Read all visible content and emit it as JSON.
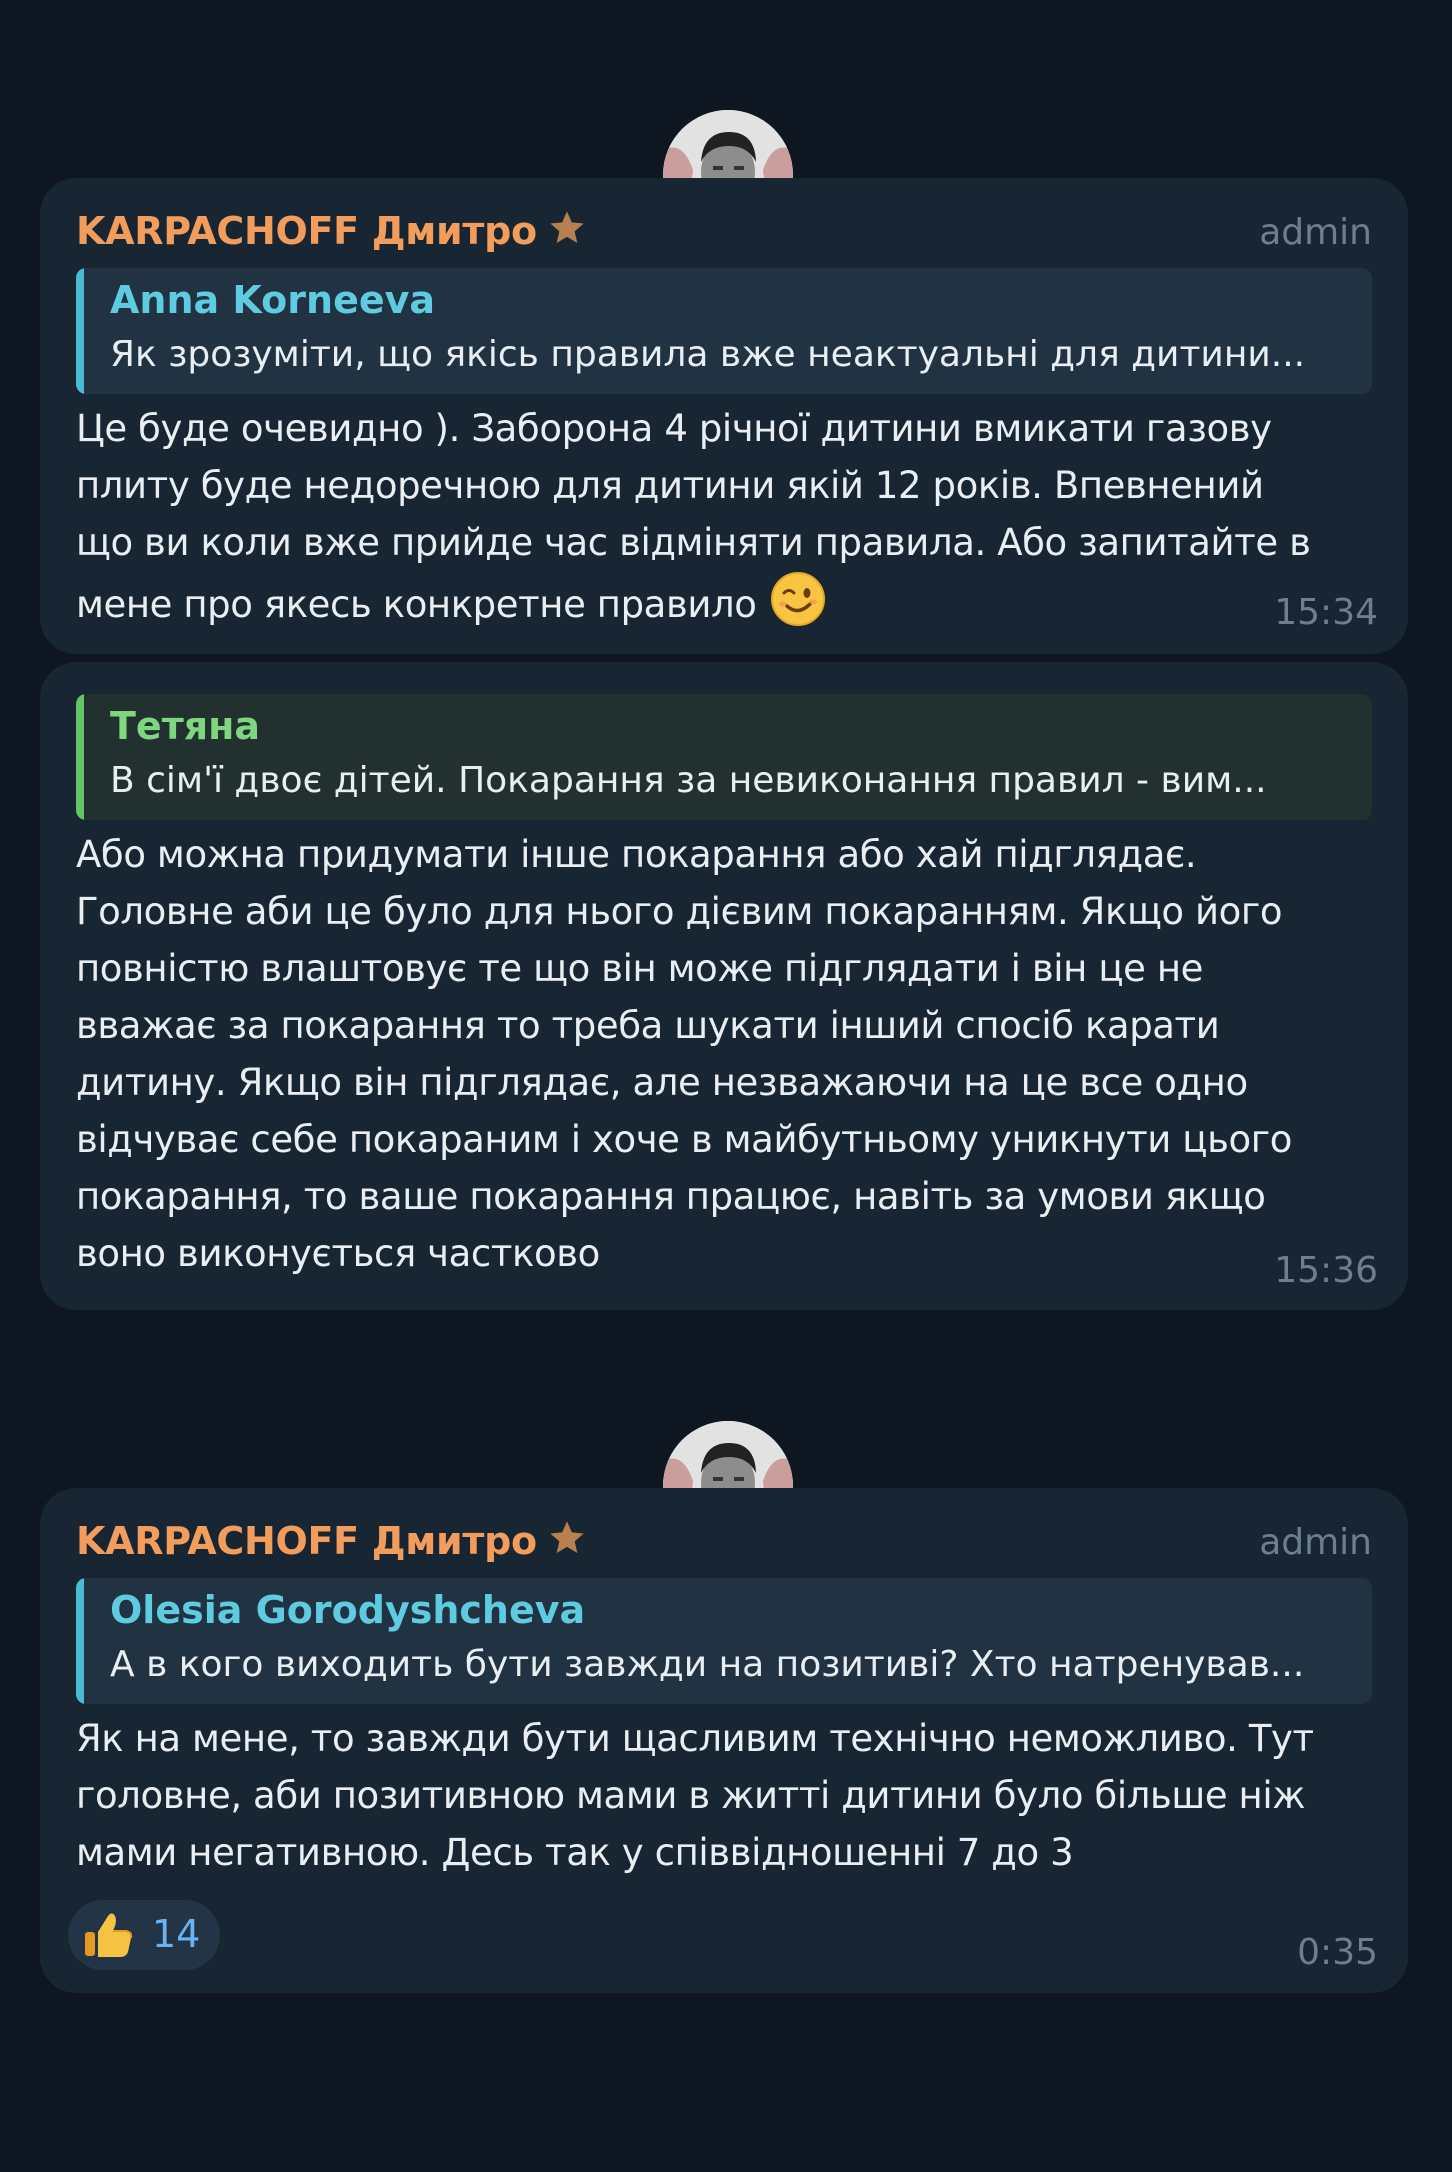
{
  "messages": [
    {
      "author": "KARPACHOFF Дмитро",
      "role": "admin",
      "reply": {
        "name": "Anna Korneeva",
        "text": "Як зрозуміти, що якісь правила вже неактуальні для дитини..."
      },
      "lines": [
        "Це буде очевидно ). Заборона 4 річної дитини вмикати газову",
        "плиту буде недоречною для дитини якій 12 років. Впевнений",
        "що ви коли вже прийде час відміняти правила. Або запитайте в",
        "мене про якесь конкретне правило"
      ],
      "emoji": "wink-emoji",
      "time": "15:34"
    },
    {
      "reply": {
        "name": "Тетяна",
        "text": "В сім'ї двоє дітей. Покарання за невиконання правил - вим..."
      },
      "lines": [
        "Або можна придумати інше покарання або хай підглядає.",
        "Головне аби це було для нього дієвим покаранням. Якщо його",
        "повністю влаштовує те що він може підглядати і він це не",
        "вважає за покарання то треба шукати інший спосіб карати",
        "дитину. Якщо він підглядає, але незважаючи на це все одно",
        "відчуває себе покараним і хоче в майбутньому уникнути цього",
        "покарання, то ваше покарання працює, навіть за умови якщо",
        "воно виконується частково"
      ],
      "time": "15:36"
    },
    {
      "author": "KARPACHOFF Дмитро",
      "role": "admin",
      "reply": {
        "name": "Olesia Gorodyshcheva",
        "text": "А в кого виходить бути завжди на позитиві? Хто натренував..."
      },
      "lines": [
        "Як на мене, то завжди бути щасливим технічно неможливо. Тут",
        "головне, аби позитивною мами в житті дитини було більше ніж",
        "мами негативною. Десь так у співвідношенні 7 до 3"
      ],
      "reaction": {
        "emoji": "thumbs-up-icon",
        "count": "14"
      },
      "time": "0:35"
    }
  ],
  "colors": {
    "background": "#0e1621",
    "bubble": "#182533",
    "author": "#f29d5b",
    "reply_blue": "#4bbcd5",
    "reply_green": "#65c467",
    "meta": "#6d7f8f",
    "reaction_count": "#6ab3f3"
  }
}
